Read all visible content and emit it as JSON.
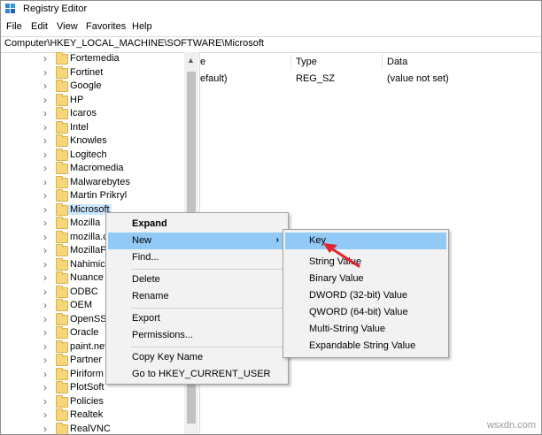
{
  "window": {
    "title": "Registry Editor"
  },
  "menu": [
    "File",
    "Edit",
    "View",
    "Favorites",
    "Help"
  ],
  "address": "Computer\\HKEY_LOCAL_MACHINE\\SOFTWARE\\Microsoft",
  "tree": [
    "Fortemedia",
    "Fortinet",
    "Google",
    "HP",
    "Icaros",
    "Intel",
    "Knowles",
    "Logitech",
    "Macromedia",
    "Malwarebytes",
    "Martin Prikryl",
    "Microsoft",
    "Mozilla",
    "mozilla.c",
    "MozillaP",
    "Nahimic",
    "Nuance",
    "ODBC",
    "OEM",
    "OpenSSH",
    "Oracle",
    "paint.net",
    "Partner",
    "Piriform",
    "PlotSoft",
    "Policies",
    "Realtek",
    "RealVNC"
  ],
  "selected_key": "Microsoft",
  "columns": {
    "name": "e",
    "type": "Type",
    "data": "Data"
  },
  "values_row": {
    "name": "efault)",
    "type": "REG_SZ",
    "data": "(value not set)"
  },
  "context_menu": {
    "expand": "Expand",
    "new": "New",
    "find": "Find...",
    "delete": "Delete",
    "rename": "Rename",
    "export": "Export",
    "permissions": "Permissions...",
    "copy_key_name": "Copy Key Name",
    "goto": "Go to HKEY_CURRENT_USER"
  },
  "submenu": [
    "Key",
    "String Value",
    "Binary Value",
    "DWORD (32-bit) Value",
    "QWORD (64-bit) Value",
    "Multi-String Value",
    "Expandable String Value"
  ],
  "watermark": "wsxdn.com",
  "colors": {
    "highlight": "#91c9f7",
    "selection": "#cce8ff",
    "arrow": "#e3242b"
  }
}
